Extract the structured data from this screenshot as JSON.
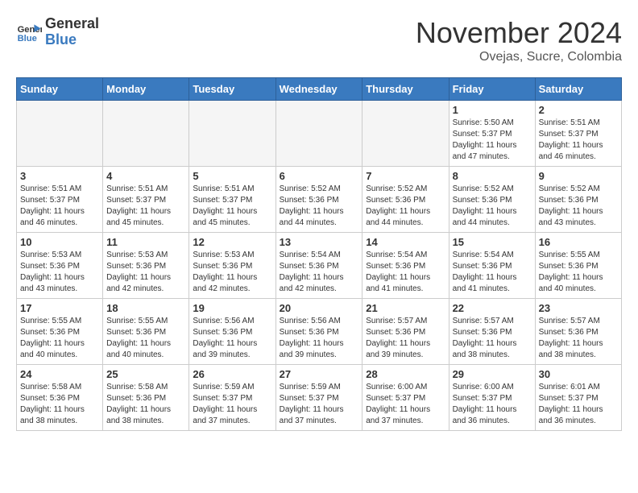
{
  "header": {
    "logo_line1": "General",
    "logo_line2": "Blue",
    "month": "November 2024",
    "location": "Ovejas, Sucre, Colombia"
  },
  "weekdays": [
    "Sunday",
    "Monday",
    "Tuesday",
    "Wednesday",
    "Thursday",
    "Friday",
    "Saturday"
  ],
  "weeks": [
    [
      {
        "day": "",
        "info": ""
      },
      {
        "day": "",
        "info": ""
      },
      {
        "day": "",
        "info": ""
      },
      {
        "day": "",
        "info": ""
      },
      {
        "day": "",
        "info": ""
      },
      {
        "day": "1",
        "info": "Sunrise: 5:50 AM\nSunset: 5:37 PM\nDaylight: 11 hours\nand 47 minutes."
      },
      {
        "day": "2",
        "info": "Sunrise: 5:51 AM\nSunset: 5:37 PM\nDaylight: 11 hours\nand 46 minutes."
      }
    ],
    [
      {
        "day": "3",
        "info": "Sunrise: 5:51 AM\nSunset: 5:37 PM\nDaylight: 11 hours\nand 46 minutes."
      },
      {
        "day": "4",
        "info": "Sunrise: 5:51 AM\nSunset: 5:37 PM\nDaylight: 11 hours\nand 45 minutes."
      },
      {
        "day": "5",
        "info": "Sunrise: 5:51 AM\nSunset: 5:37 PM\nDaylight: 11 hours\nand 45 minutes."
      },
      {
        "day": "6",
        "info": "Sunrise: 5:52 AM\nSunset: 5:36 PM\nDaylight: 11 hours\nand 44 minutes."
      },
      {
        "day": "7",
        "info": "Sunrise: 5:52 AM\nSunset: 5:36 PM\nDaylight: 11 hours\nand 44 minutes."
      },
      {
        "day": "8",
        "info": "Sunrise: 5:52 AM\nSunset: 5:36 PM\nDaylight: 11 hours\nand 44 minutes."
      },
      {
        "day": "9",
        "info": "Sunrise: 5:52 AM\nSunset: 5:36 PM\nDaylight: 11 hours\nand 43 minutes."
      }
    ],
    [
      {
        "day": "10",
        "info": "Sunrise: 5:53 AM\nSunset: 5:36 PM\nDaylight: 11 hours\nand 43 minutes."
      },
      {
        "day": "11",
        "info": "Sunrise: 5:53 AM\nSunset: 5:36 PM\nDaylight: 11 hours\nand 42 minutes."
      },
      {
        "day": "12",
        "info": "Sunrise: 5:53 AM\nSunset: 5:36 PM\nDaylight: 11 hours\nand 42 minutes."
      },
      {
        "day": "13",
        "info": "Sunrise: 5:54 AM\nSunset: 5:36 PM\nDaylight: 11 hours\nand 42 minutes."
      },
      {
        "day": "14",
        "info": "Sunrise: 5:54 AM\nSunset: 5:36 PM\nDaylight: 11 hours\nand 41 minutes."
      },
      {
        "day": "15",
        "info": "Sunrise: 5:54 AM\nSunset: 5:36 PM\nDaylight: 11 hours\nand 41 minutes."
      },
      {
        "day": "16",
        "info": "Sunrise: 5:55 AM\nSunset: 5:36 PM\nDaylight: 11 hours\nand 40 minutes."
      }
    ],
    [
      {
        "day": "17",
        "info": "Sunrise: 5:55 AM\nSunset: 5:36 PM\nDaylight: 11 hours\nand 40 minutes."
      },
      {
        "day": "18",
        "info": "Sunrise: 5:55 AM\nSunset: 5:36 PM\nDaylight: 11 hours\nand 40 minutes."
      },
      {
        "day": "19",
        "info": "Sunrise: 5:56 AM\nSunset: 5:36 PM\nDaylight: 11 hours\nand 39 minutes."
      },
      {
        "day": "20",
        "info": "Sunrise: 5:56 AM\nSunset: 5:36 PM\nDaylight: 11 hours\nand 39 minutes."
      },
      {
        "day": "21",
        "info": "Sunrise: 5:57 AM\nSunset: 5:36 PM\nDaylight: 11 hours\nand 39 minutes."
      },
      {
        "day": "22",
        "info": "Sunrise: 5:57 AM\nSunset: 5:36 PM\nDaylight: 11 hours\nand 38 minutes."
      },
      {
        "day": "23",
        "info": "Sunrise: 5:57 AM\nSunset: 5:36 PM\nDaylight: 11 hours\nand 38 minutes."
      }
    ],
    [
      {
        "day": "24",
        "info": "Sunrise: 5:58 AM\nSunset: 5:36 PM\nDaylight: 11 hours\nand 38 minutes."
      },
      {
        "day": "25",
        "info": "Sunrise: 5:58 AM\nSunset: 5:36 PM\nDaylight: 11 hours\nand 38 minutes."
      },
      {
        "day": "26",
        "info": "Sunrise: 5:59 AM\nSunset: 5:37 PM\nDaylight: 11 hours\nand 37 minutes."
      },
      {
        "day": "27",
        "info": "Sunrise: 5:59 AM\nSunset: 5:37 PM\nDaylight: 11 hours\nand 37 minutes."
      },
      {
        "day": "28",
        "info": "Sunrise: 6:00 AM\nSunset: 5:37 PM\nDaylight: 11 hours\nand 37 minutes."
      },
      {
        "day": "29",
        "info": "Sunrise: 6:00 AM\nSunset: 5:37 PM\nDaylight: 11 hours\nand 36 minutes."
      },
      {
        "day": "30",
        "info": "Sunrise: 6:01 AM\nSunset: 5:37 PM\nDaylight: 11 hours\nand 36 minutes."
      }
    ]
  ]
}
